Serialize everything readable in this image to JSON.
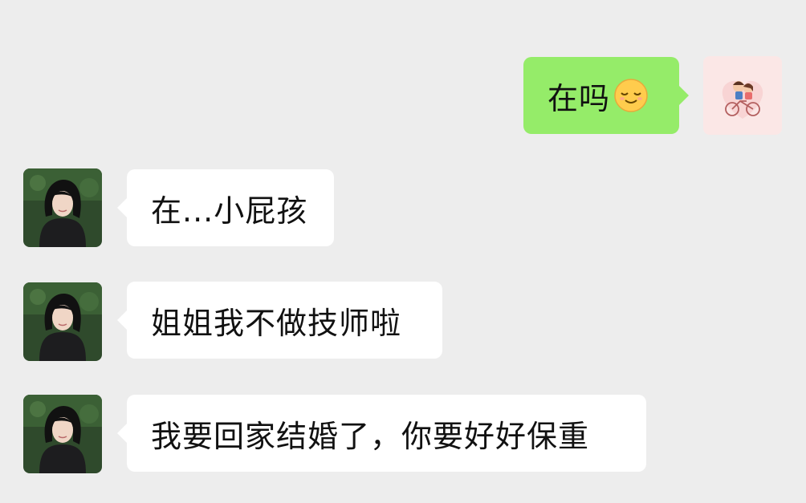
{
  "messages": [
    {
      "side": "out",
      "text": "在吗",
      "emoji": "sleepy-smile-emoji",
      "avatar": "couple-on-bicycle-avatar"
    },
    {
      "side": "in",
      "text": "在...小屁孩",
      "avatar": "woman-selfie-avatar"
    },
    {
      "side": "in",
      "text": "姐姐我不做技师啦",
      "avatar": "woman-selfie-avatar"
    },
    {
      "side": "in",
      "text": "我要回家结婚了，你要好好保重",
      "avatar": "woman-selfie-avatar"
    }
  ],
  "colors": {
    "background": "#ededed",
    "outgoing_bubble": "#95ec69",
    "incoming_bubble": "#ffffff"
  }
}
